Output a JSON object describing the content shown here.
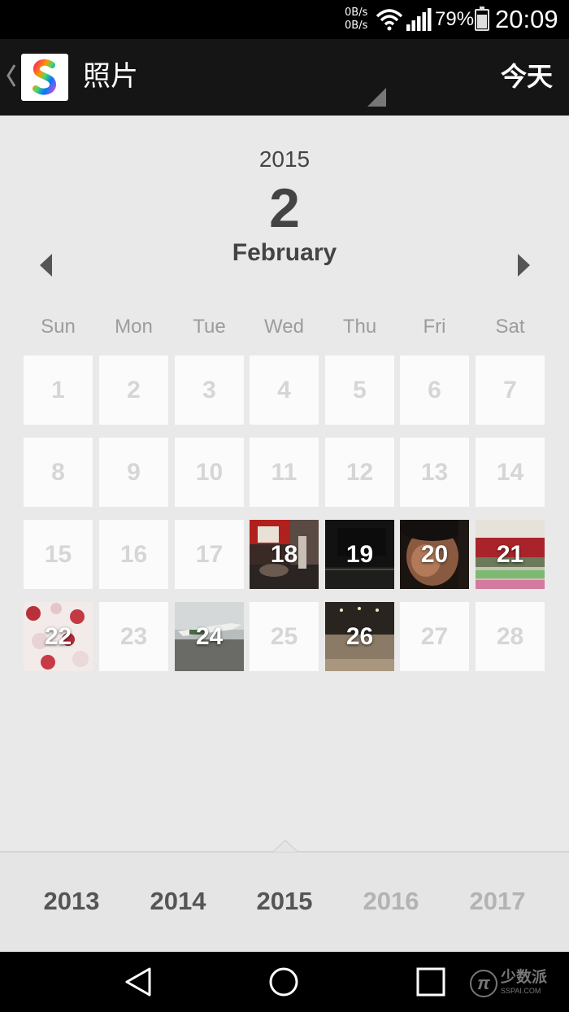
{
  "status_bar": {
    "net_up": "0B/s",
    "net_down": "0B/s",
    "battery_pct": "79%",
    "time": "20:09"
  },
  "app_bar": {
    "title": "照片",
    "today_label": "今天",
    "icons": {
      "back": "chevron-left-icon",
      "logo": "s-logo-icon",
      "spinner": "dropdown-triangle-icon"
    }
  },
  "header": {
    "year": "2015",
    "day": "2",
    "month": "February"
  },
  "weekdays": [
    "Sun",
    "Mon",
    "Tue",
    "Wed",
    "Thu",
    "Fri",
    "Sat"
  ],
  "calendar": {
    "weeks": [
      [
        "1",
        "2",
        "3",
        "4",
        "5",
        "6",
        "7"
      ],
      [
        "8",
        "9",
        "10",
        "11",
        "12",
        "13",
        "14"
      ],
      [
        "15",
        "16",
        "17",
        "18",
        "19",
        "20",
        "21"
      ],
      [
        "22",
        "23",
        "24",
        "25",
        "26",
        "27",
        "28"
      ]
    ],
    "days_with_photos": [
      "18",
      "19",
      "20",
      "21",
      "22",
      "24",
      "26"
    ]
  },
  "year_selector": {
    "years": [
      "2013",
      "2014",
      "2015",
      "2016",
      "2017"
    ],
    "selected": "2015"
  },
  "nav_bar": {
    "icons": [
      "back-triangle-icon",
      "home-circle-icon",
      "recents-square-icon"
    ]
  },
  "watermark": {
    "symbol": "π",
    "text": "少数派",
    "subtext": "SSPAI.COM"
  },
  "colors": {
    "app_bar_bg": "#151515",
    "content_bg": "#e9e9e9",
    "cell_bg": "#fbfbfb",
    "cell_text_empty": "#d6d6d6"
  }
}
